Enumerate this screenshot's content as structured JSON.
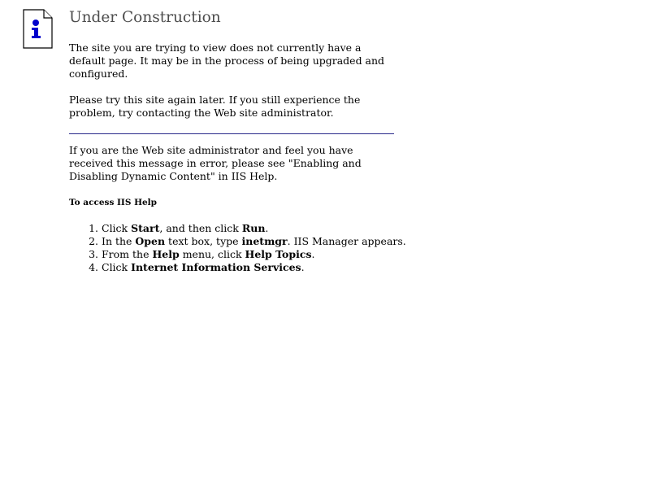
{
  "page": {
    "title": "Under Construction",
    "intro": "The site you are trying to view does not currently have a default page. It may be in the process of being upgraded and configured.",
    "retry": "Please try this site again later. If you still experience the problem, try contacting the Web site administrator.",
    "admin_note": "If you are the Web site administrator and feel you have received this message in error, please see \"Enabling and Disabling Dynamic Content\" in IIS Help.",
    "help_heading": "To access IIS Help"
  },
  "steps": [
    {
      "parts": [
        "Click ",
        "Start",
        ", and then click ",
        "Run",
        "."
      ]
    },
    {
      "parts": [
        "In the ",
        "Open",
        " text box, type ",
        "inetmgr",
        ". IIS Manager appears."
      ]
    },
    {
      "parts": [
        "From the ",
        "Help",
        " menu, click ",
        "Help Topics",
        "."
      ]
    },
    {
      "parts": [
        "Click ",
        "Internet Information Services",
        "."
      ]
    }
  ],
  "icon": {
    "name": "info-icon",
    "accent": "#0000cc"
  },
  "colors": {
    "title": "#4d4d4d",
    "rule": "#2a2a8a"
  }
}
